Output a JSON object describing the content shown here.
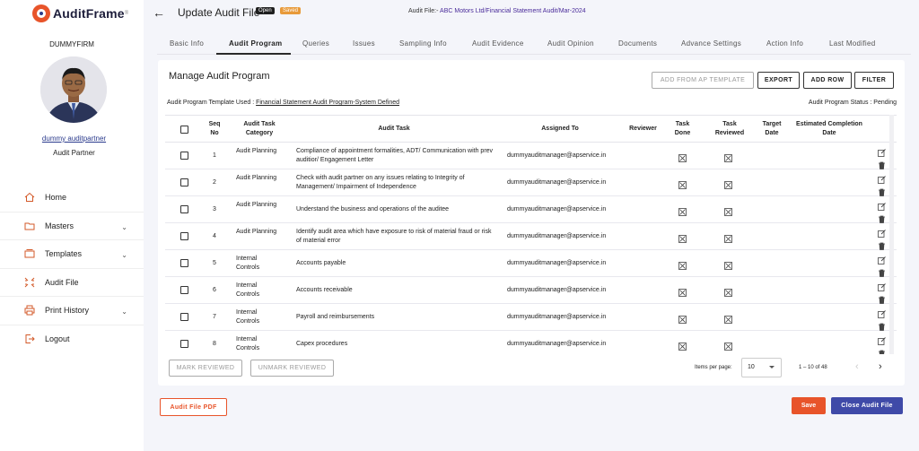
{
  "brand": {
    "name": "AuditFrame",
    "reg": "®"
  },
  "user": {
    "firm": "DUMMYFIRM",
    "name": "dummy auditpartner",
    "role": "Audit Partner"
  },
  "nav": {
    "home": "Home",
    "masters": "Masters",
    "templates": "Templates",
    "audit_file": "Audit File",
    "print_history": "Print History",
    "logout": "Logout"
  },
  "header": {
    "title": "Update Audit File",
    "badge_open": "Open",
    "badge_saved": "Saved",
    "audit_file_prefix": "Audit File:-",
    "audit_file_value": "ABC Motors Ltd/Financial Statement Audit/Mar-2024"
  },
  "tabs": [
    "Basic Info",
    "Audit Program",
    "Queries",
    "Issues",
    "Sampling Info",
    "Audit Evidence",
    "Audit Opinion",
    "Documents",
    "Advance Settings",
    "Action Info",
    "Last Modified"
  ],
  "active_tab": "Audit Program",
  "program": {
    "title": "Manage Audit Program",
    "buttons": {
      "from_template": "ADD FROM AP TEMPLATE",
      "export": "EXPORT",
      "add_row": "ADD ROW",
      "filter": "FILTER"
    },
    "template_label": "Audit Program Template Used :",
    "template_value": "Financial Statement Audit Program-System Defined",
    "status_label": "Audit Program Status :",
    "status_value": "Pending"
  },
  "table": {
    "headers": {
      "seq": "Seq No",
      "category": "Audit Task Category",
      "task": "Audit Task",
      "assigned": "Assigned To",
      "reviewer": "Reviewer",
      "done": "Task Done",
      "reviewed": "Task Reviewed",
      "target": "Target Date",
      "estimated": "Estimated Completion Date"
    },
    "rows": [
      {
        "seq": "1",
        "category": "Audit Planning",
        "task": "Compliance of appointment formalities, ADT/ Communication with prev auditior/ Engagement Letter",
        "assigned": "dummyauditmanager@apservice.in"
      },
      {
        "seq": "2",
        "category": "Audit Planning",
        "task": "Check with audit partner on any issues relating to Integrity of Management/ Impairment of Independence",
        "assigned": "dummyauditmanager@apservice.in"
      },
      {
        "seq": "3",
        "category": "Audit Planning",
        "task": "Understand the business and operations of the auditee",
        "assigned": "dummyauditmanager@apservice.in"
      },
      {
        "seq": "4",
        "category": "Audit Planning",
        "task": "Identify audit area which have exposure to risk of material fraud or risk of material error",
        "assigned": "dummyauditmanager@apservice.in"
      },
      {
        "seq": "5",
        "category": "Internal Controls",
        "task": "Accounts payable",
        "assigned": "dummyauditmanager@apservice.in"
      },
      {
        "seq": "6",
        "category": "Internal Controls",
        "task": "Accounts receivable",
        "assigned": "dummyauditmanager@apservice.in"
      },
      {
        "seq": "7",
        "category": "Internal Controls",
        "task": "Payroll and reimbursements",
        "assigned": "dummyauditmanager@apservice.in"
      },
      {
        "seq": "8",
        "category": "Internal Controls",
        "task": "Capex procedures",
        "assigned": "dummyauditmanager@apservice.in"
      }
    ]
  },
  "bulk": {
    "mark": "MARK REVIEWED",
    "unmark": "UNMARK REVIEWED"
  },
  "pagination": {
    "items_label": "Items per page:",
    "items_value": "10",
    "range": "1 – 10 of 48"
  },
  "footer": {
    "pdf": "Audit File PDF",
    "save": "Save",
    "close": "Close Audit File"
  },
  "colors": {
    "accent": "#e8542a",
    "primary": "#3f4aa8"
  }
}
